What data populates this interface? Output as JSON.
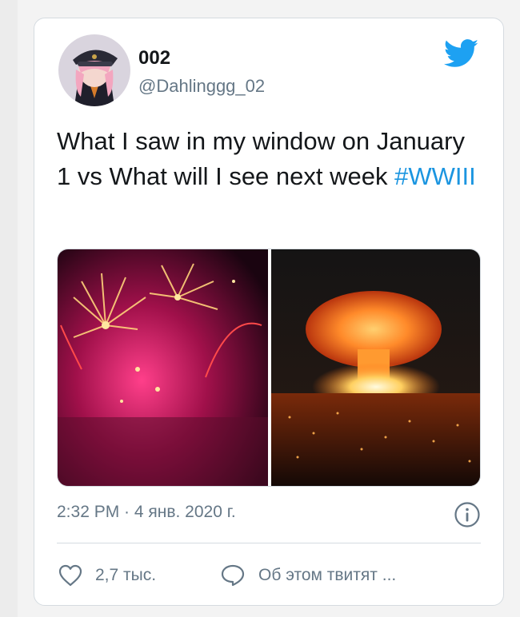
{
  "tweet": {
    "display_name": "002",
    "handle": "@Dahlinggg_02",
    "text_before": "What I saw in my window on January 1 vs What will I see next week ",
    "hashtag": "#WWIII",
    "timestamp": "2:32 PM · 4 янв. 2020 г.",
    "likes_label": "2,7 тыс.",
    "discussion_label": "Об этом твитят ..."
  },
  "icons": {
    "brand": "twitter-bird-icon",
    "info": "info-icon",
    "like": "heart-icon",
    "reply": "speech-bubble-icon"
  },
  "colors": {
    "twitter_blue": "#1da1f2",
    "hashtag": "#1b95e0",
    "secondary_text": "#657786",
    "primary_text": "#14171a",
    "border": "#d5dbe0"
  }
}
